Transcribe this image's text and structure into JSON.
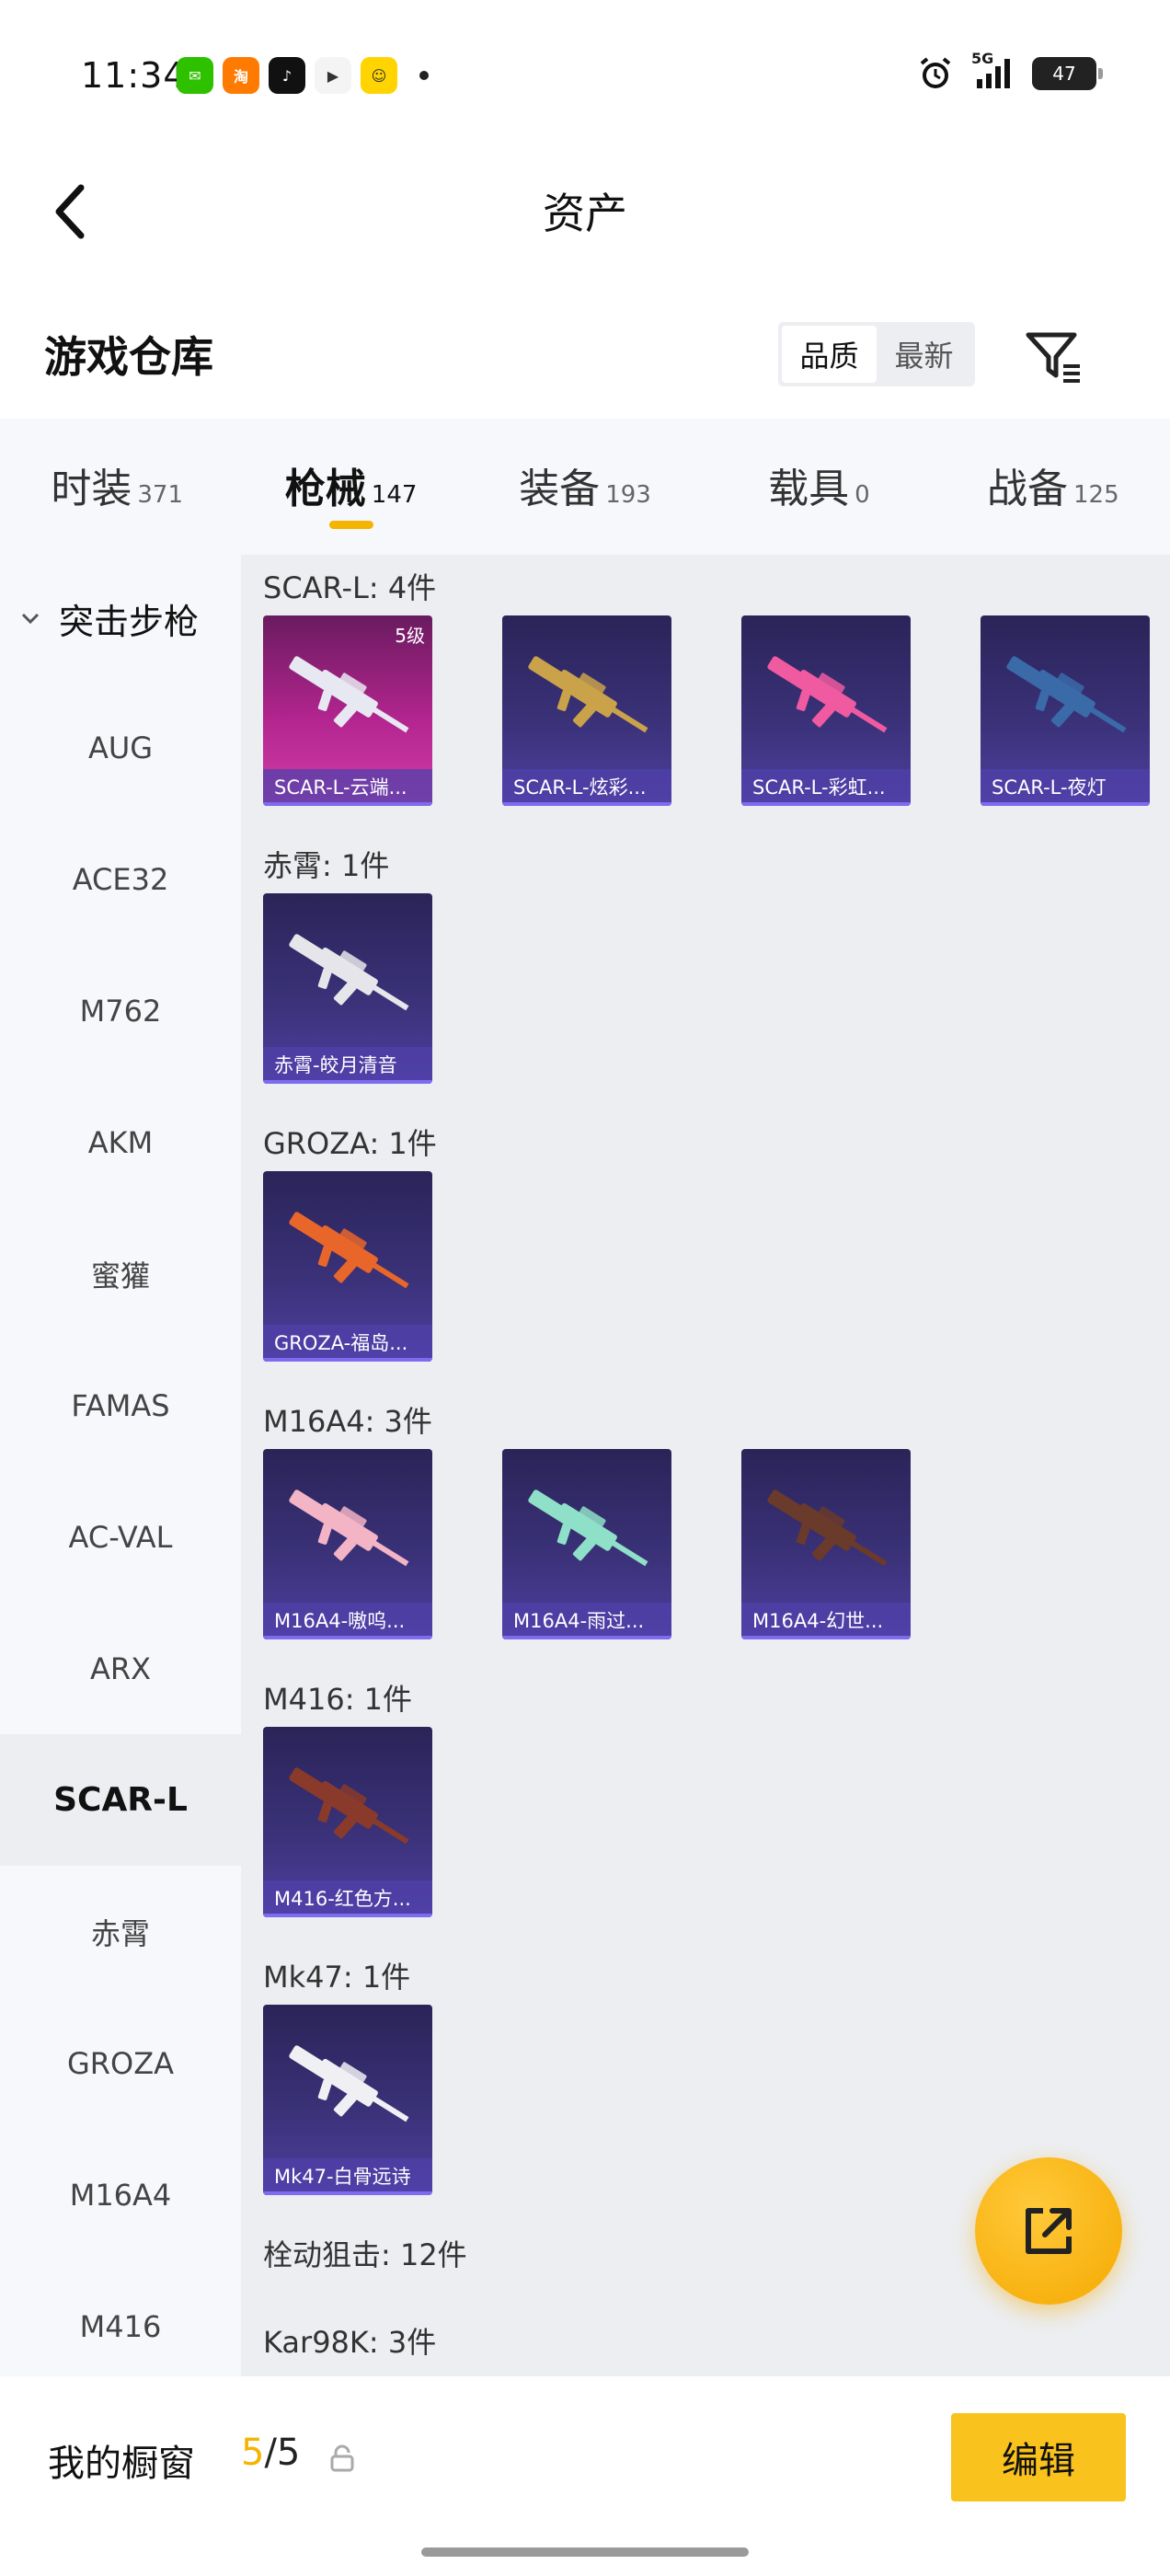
{
  "status_bar": {
    "time": "11:34",
    "network": "5G",
    "battery": "47",
    "apps": [
      {
        "name": "wechat-icon",
        "color": "#2dc100",
        "glyph": "✉"
      },
      {
        "name": "taobao-icon",
        "color": "#ff7a00",
        "glyph": "淘"
      },
      {
        "name": "tiktok-icon",
        "color": "#111111",
        "glyph": "♪"
      },
      {
        "name": "tencent-video-icon",
        "color": "#f4f4f4",
        "glyph": "▶"
      },
      {
        "name": "game-app-icon",
        "color": "#ffd400",
        "glyph": "☺"
      }
    ]
  },
  "header": {
    "title": "资产",
    "back_label": "返回"
  },
  "warehouse": {
    "title": "游戏仓库",
    "sort_options": [
      "品质",
      "最新"
    ],
    "sort_active": 0
  },
  "tabs": [
    {
      "label": "时装",
      "count": "371"
    },
    {
      "label": "枪械",
      "count": "147"
    },
    {
      "label": "装备",
      "count": "193"
    },
    {
      "label": "载具",
      "count": "0"
    },
    {
      "label": "战备",
      "count": "125"
    }
  ],
  "active_tab": 1,
  "sidebar": {
    "group_label": "突击步枪",
    "items": [
      "AUG",
      "ACE32",
      "M762",
      "AKM",
      "蜜獾",
      "FAMAS",
      "AC-VAL",
      "ARX",
      "SCAR-L",
      "赤霄",
      "GROZA",
      "M16A4",
      "M416"
    ],
    "active_item": "SCAR-L"
  },
  "sections": [
    {
      "title": "SCAR-L: 4件",
      "cards": [
        {
          "label": "SCAR-L-云端...",
          "level": "5级",
          "style": "pink",
          "gun_color": "#e8e8f2"
        },
        {
          "label": "SCAR-L-炫彩...",
          "level": "",
          "style": "purple",
          "gun_color": "#c9a24a"
        },
        {
          "label": "SCAR-L-彩虹...",
          "level": "",
          "style": "purple",
          "gun_color": "#ef5aa0"
        },
        {
          "label": "SCAR-L-夜灯",
          "level": "",
          "style": "purple",
          "gun_color": "#3a6aa8"
        }
      ]
    },
    {
      "title": "赤霄: 1件",
      "cards": [
        {
          "label": "赤霄-皎月清音",
          "level": "",
          "style": "purple",
          "gun_color": "#e6e6ea"
        }
      ]
    },
    {
      "title": "GROZA: 1件",
      "cards": [
        {
          "label": "GROZA-福岛...",
          "level": "",
          "style": "purple",
          "gun_color": "#e8662a"
        }
      ]
    },
    {
      "title": "M16A4: 3件",
      "cards": [
        {
          "label": "M16A4-嗷呜...",
          "level": "",
          "style": "purple",
          "gun_color": "#f3b4c6"
        },
        {
          "label": "M16A4-雨过...",
          "level": "",
          "style": "purple",
          "gun_color": "#8fe0c8"
        },
        {
          "label": "M16A4-幻世...",
          "level": "",
          "style": "purple",
          "gun_color": "#6a3a2a"
        }
      ]
    },
    {
      "title": "M416: 1件",
      "cards": [
        {
          "label": "M416-红色方...",
          "level": "",
          "style": "purple",
          "gun_color": "#8a3a2a"
        }
      ]
    },
    {
      "title": "Mk47: 1件",
      "cards": [
        {
          "label": "Mk47-白骨远诗",
          "level": "",
          "style": "purple",
          "gun_color": "#f0f0f4"
        }
      ]
    },
    {
      "title": "栓动狙击: 12件",
      "cards": []
    },
    {
      "title": "Kar98K: 3件",
      "cards": []
    }
  ],
  "bottom_bar": {
    "showcase_label": "我的橱窗",
    "showcase_current": "5",
    "showcase_total": "/5",
    "edit_label": "编辑"
  },
  "colors": {
    "accent": "#f5b400",
    "edit_button": "#f9c21c",
    "sidebar_bg": "#f6f8fb",
    "content_bg": "#eceef1"
  }
}
